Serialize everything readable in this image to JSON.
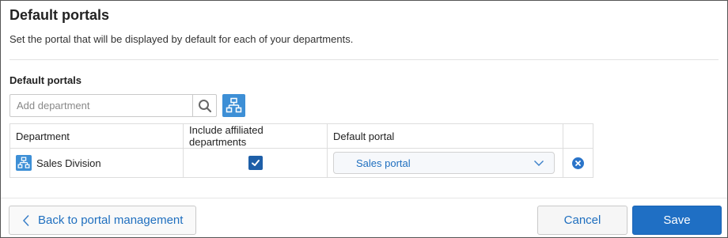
{
  "page": {
    "title": "Default portals",
    "description": "Set the portal that will be displayed by default for each of your departments."
  },
  "section": {
    "title": "Default portals"
  },
  "search": {
    "placeholder": "Add department",
    "value": ""
  },
  "icons": {
    "search": "search-icon",
    "org_chart": "org-chart-icon",
    "checkmark": "check-icon",
    "chevron": "chevron-down-icon",
    "remove": "remove-icon",
    "back": "chevron-left-icon"
  },
  "table": {
    "headers": [
      "Department",
      "Include affiliated departments",
      "Default portal",
      ""
    ],
    "rows": [
      {
        "department": "Sales Division",
        "include_affiliated": true,
        "default_portal": "Sales portal"
      }
    ]
  },
  "footer": {
    "back_label": "Back to portal management",
    "cancel_label": "Cancel",
    "save_label": "Save"
  },
  "colors": {
    "accent": "#1f6fc4",
    "icon_blue": "#3d8fd6",
    "link_text": "#1f6fbf"
  }
}
